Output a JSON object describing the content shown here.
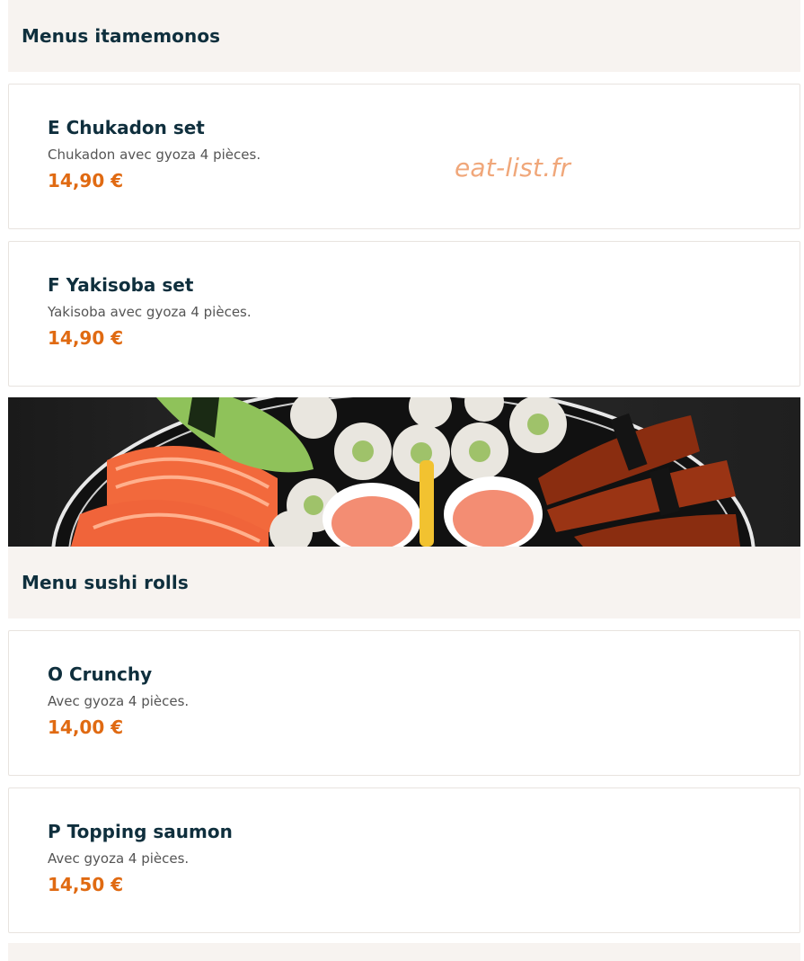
{
  "sections": [
    {
      "title": "Menus itamemonos",
      "items": [
        {
          "name": "E Chukadon set",
          "description": "Chukadon avec gyoza 4 pièces.",
          "price": "14,90 €"
        },
        {
          "name": "F Yakisoba set",
          "description": "Yakisoba avec gyoza 4 pièces.",
          "price": "14,90 €"
        }
      ]
    },
    {
      "title": "Menu sushi rolls",
      "items": [
        {
          "name": "O Crunchy",
          "description": "Avec gyoza 4 pièces.",
          "price": "14,00 €"
        },
        {
          "name": "P Topping saumon",
          "description": "Avec gyoza 4 pièces.",
          "price": "14,50 €"
        }
      ]
    }
  ],
  "watermark": "eat-list.fr",
  "colors": {
    "heading": "#0f2f3d",
    "price": "#e06a12",
    "section_bg": "#f7f3f0",
    "watermark": "#f0a77a"
  }
}
